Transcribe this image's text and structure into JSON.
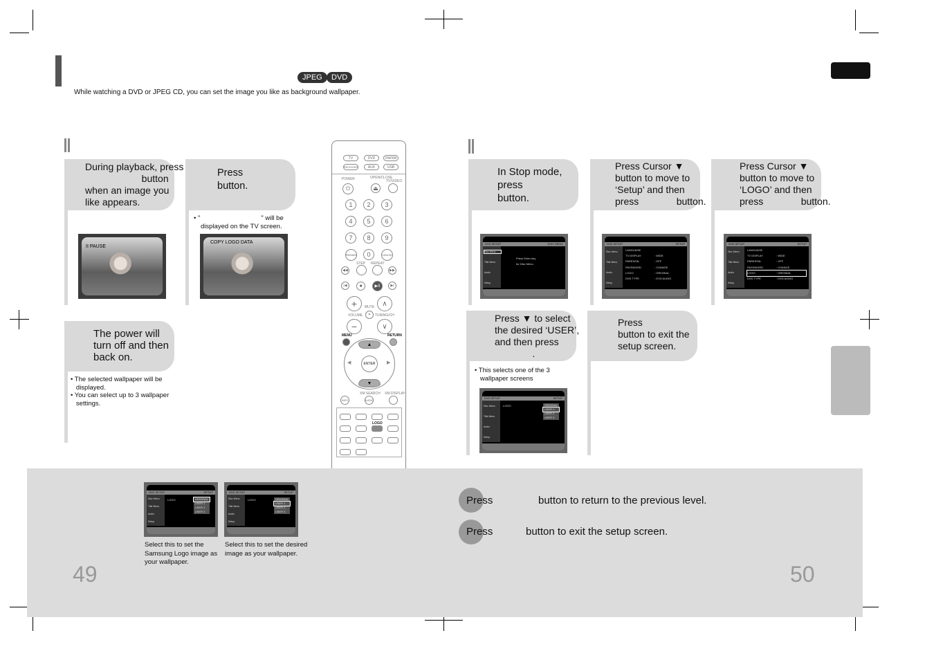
{
  "header": {
    "badges": [
      "JPEG",
      "DVD"
    ],
    "subtitle": "While watching a DVD or JPEG CD, you can set the image you like as background wallpaper."
  },
  "left_steps": [
    {
      "text": "During playback, press\n                     button\nwhen an image you\nlike appears.",
      "screen_label": "II PAUSE"
    },
    {
      "text": "Press\nbutton.",
      "note_1": "• \"",
      "note_2": "\" will be",
      "note_3": "displayed on the TV screen.",
      "screen_label": "COPY LOGO DATA"
    },
    {
      "text": "The power will\nturn off and then\nback on.",
      "notes": [
        "• The selected wallpaper will be",
        "   displayed.",
        "• You can select up to 3 wallpaper",
        "   settings."
      ]
    }
  ],
  "right_steps": [
    {
      "text": "In Stop mode,\npress\nbutton."
    },
    {
      "text": "Press Cursor ▼\nbutton to move to\n‘Setup’ and then\npress              button."
    },
    {
      "text": "Press Cursor ▼\nbutton to move to\n‘LOGO’ and then\npress              button."
    },
    {
      "text": "Press ▼ to select\nthe desired ‘USER’,\nand then press\n              .",
      "note": [
        "• This selects one of the 3",
        "   wallpaper screens"
      ]
    },
    {
      "text": "Press\nbutton to exit the\nsetup screen."
    }
  ],
  "screens": {
    "disc_menu": {
      "left": "DVD SETUP",
      "right": "DISC MENU",
      "side": [
        "Disc Menu",
        "Title Menu",
        "Audio",
        "Setup"
      ],
      "msg": [
        "Press Enter key",
        "for Disc Menu"
      ]
    },
    "setup": {
      "left": "DVD SETUP",
      "right": "SETUP",
      "rows": [
        [
          "LANGUAGE",
          ""
        ],
        [
          "TV DISPLAY",
          ": WIDE"
        ],
        [
          "PARENTAL",
          ": OFF"
        ],
        [
          "PASSWORD",
          ": CHANGE"
        ],
        [
          "LOGO",
          ": ORIGINAL"
        ],
        [
          "DVD TYPE",
          ": DVD AUDIO"
        ]
      ]
    },
    "logo": {
      "item": "LOGO",
      "options": [
        "ORIGINAL",
        "USER 1",
        "USER 2",
        "USER 3"
      ]
    }
  },
  "remote": {
    "top_buttons": [
      "TV",
      "DVD",
      "FM/XM",
      "RECEIVER",
      "AUX",
      "USB"
    ],
    "labels": [
      "POWER",
      "OPEN/CLOSE",
      "TV/VIDEO",
      "STEP",
      "REPEAT",
      "MUTE",
      "VOLUME",
      "TUNING/CH",
      "MENU",
      "RETURN",
      "ENTER",
      "XM SEARCH",
      "XM DISPLAY",
      "INFO",
      "AUDIO",
      "LOGO"
    ],
    "numbers": [
      "1",
      "2",
      "3",
      "4",
      "5",
      "6",
      "7",
      "8",
      "9",
      "REMAIN",
      "0",
      "CANCEL"
    ]
  },
  "bottom": {
    "captions": [
      "Select this to set the Samsung Logo image as your wallpaper.",
      "Select this to set the desired image as your wallpaper."
    ],
    "lines": [
      {
        "press": "Press",
        "text": "button to return to the previous level."
      },
      {
        "press": "Press",
        "text": "button to exit the setup screen."
      }
    ],
    "page_left": "49",
    "page_right": "50"
  }
}
